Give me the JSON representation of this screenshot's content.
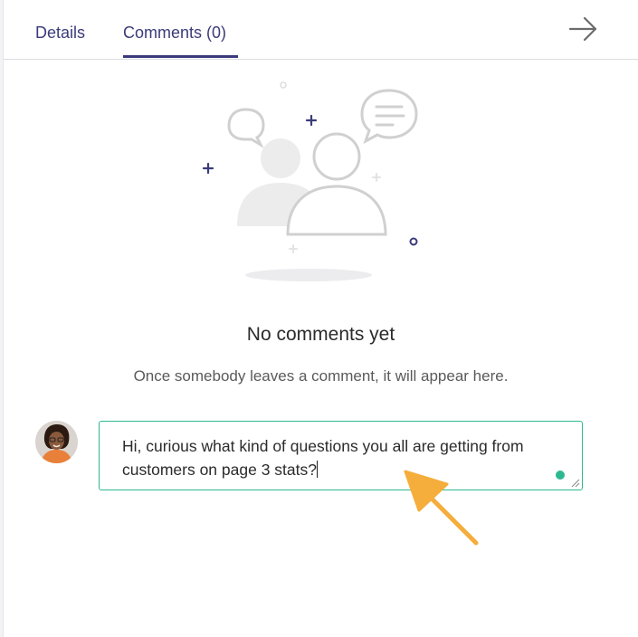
{
  "tabs": [
    {
      "label": "Details"
    },
    {
      "label": "Comments (0)"
    }
  ],
  "empty_state": {
    "title": "No comments yet",
    "subtitle": "Once somebody leaves a comment, it will appear here."
  },
  "comment_input": {
    "value": "Hi, curious what kind of questions you all are getting from customers on page 3 stats?"
  },
  "icons": {
    "close": "arrow-right-icon",
    "avatar": "user-avatar",
    "pointer": "annotation-arrow"
  },
  "colors": {
    "accent": "#3b3b7a",
    "focus_border": "#2db890",
    "pointer": "#f5ad3c"
  }
}
